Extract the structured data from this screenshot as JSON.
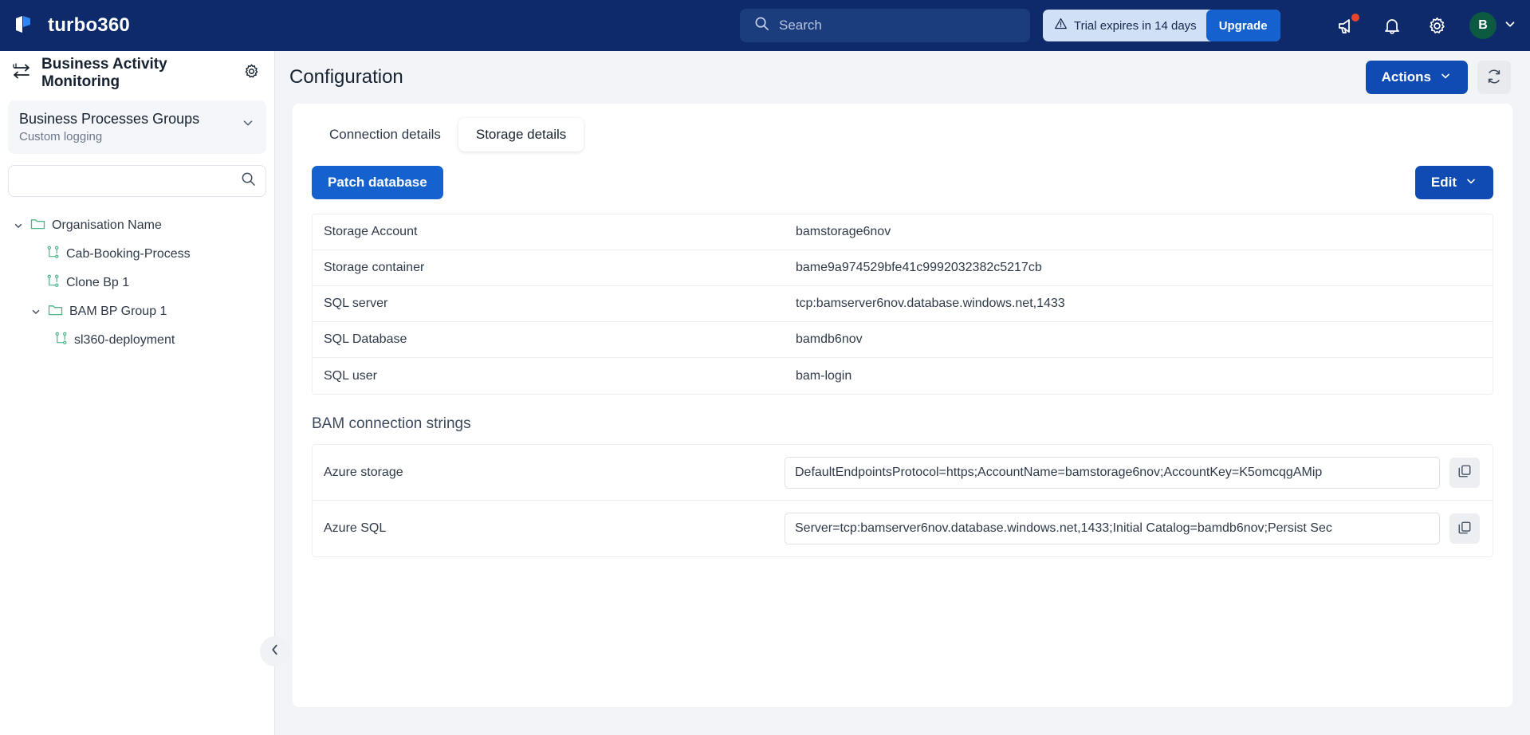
{
  "topbar": {
    "brand": "turbo360",
    "logo_icon": "turbo360-logo-icon",
    "search": {
      "placeholder": "Search",
      "value": "",
      "icon": "search-icon"
    },
    "trial": {
      "warning_icon": "warning-triangle-icon",
      "text": "Trial expires in 14 days",
      "upgrade_label": "Upgrade"
    },
    "icons": {
      "announcements": "megaphone-icon",
      "notifications": "bell-icon",
      "settings": "gear-icon",
      "chevron": "chevron-down-icon"
    },
    "avatar": {
      "initial": "B",
      "color": "#0d5a43"
    }
  },
  "sidebar": {
    "title": "Business Activity Monitoring",
    "title_icon": "activity-monitoring-icon",
    "settings_icon": "gear-icon",
    "group": {
      "title": "Business Processes Groups",
      "subtitle": "Custom logging",
      "chevron_icon": "chevron-down-icon"
    },
    "search": {
      "placeholder": "",
      "value": "",
      "icon": "search-icon"
    },
    "tree": [
      {
        "label": "Organisation Name",
        "level": 0,
        "icon": "folder-icon",
        "chevron": "chevron-down-icon",
        "expanded": true
      },
      {
        "label": "Cab-Booking-Process",
        "level": 1,
        "icon": "process-icon"
      },
      {
        "label": "Clone Bp 1",
        "level": 1,
        "icon": "process-icon"
      },
      {
        "label": "BAM BP Group 1",
        "level": 1,
        "icon": "folder-icon",
        "chevron": "chevron-down-icon",
        "expanded": true
      },
      {
        "label": "sl360-deployment",
        "level": 2,
        "icon": "process-icon"
      }
    ],
    "collapse_icon": "chevron-left-icon"
  },
  "main": {
    "page_title": "Configuration",
    "actions_label": "Actions",
    "actions_chevron": "chevron-down-icon",
    "refresh_icon": "refresh-icon",
    "tabs": [
      {
        "label": "Connection details",
        "active": false
      },
      {
        "label": "Storage details",
        "active": true
      }
    ],
    "patch_label": "Patch database",
    "edit_label": "Edit",
    "edit_chevron": "chevron-down-icon",
    "storage_rows": [
      {
        "key": "Storage Account",
        "value": "bamstorage6nov"
      },
      {
        "key": "Storage container",
        "value": "bame9a974529bfe41c9992032382c5217cb"
      },
      {
        "key": "SQL server",
        "value": "tcp:bamserver6nov.database.windows.net,1433"
      },
      {
        "key": "SQL Database",
        "value": "bamdb6nov"
      },
      {
        "key": "SQL user",
        "value": "bam-login"
      }
    ],
    "connection_section_title": "BAM connection strings",
    "connection_rows": [
      {
        "key": "Azure storage",
        "value": "DefaultEndpointsProtocol=https;AccountName=bamstorage6nov;AccountKey=K5omcqgAMip",
        "copy_icon": "copy-icon"
      },
      {
        "key": "Azure SQL",
        "value": "Server=tcp:bamserver6nov.database.windows.net,1433;Initial Catalog=bamdb6nov;Persist Sec",
        "copy_icon": "copy-icon"
      }
    ]
  },
  "colors": {
    "topbar_bg": "#0e2a6b",
    "primary": "#0f4bb3",
    "accent_blue": "#1562cf",
    "tree_green": "#4eb488",
    "page_bg": "#f3f4f7"
  }
}
